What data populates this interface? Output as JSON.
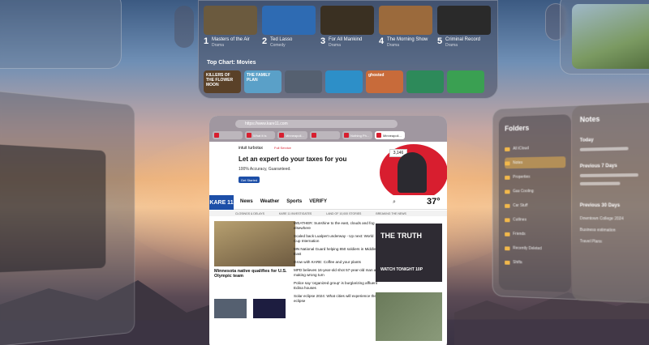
{
  "tv": {
    "top_tiles": [
      {
        "rank": "1",
        "title": "Masters of the Air",
        "genre": "Drama",
        "color": "#6b5a3e"
      },
      {
        "rank": "2",
        "title": "Ted Lasso",
        "genre": "Comedy",
        "color": "#2e6bb3"
      },
      {
        "rank": "3",
        "title": "For All Mankind",
        "genre": "Drama",
        "color": "#3a3022"
      },
      {
        "rank": "4",
        "title": "The Morning Show",
        "genre": "Drama",
        "color": "#9b6a3c"
      },
      {
        "rank": "5",
        "title": "Criminal Record",
        "genre": "Drama",
        "color": "#2a2a2a"
      }
    ],
    "chart_title": "Top Chart: Movies",
    "movie_tiles": [
      {
        "text": "KILLERS OF THE FLOWER MOON",
        "color": "#5a4128"
      },
      {
        "text": "THE FAMILY PLAN",
        "color": "#5aa0c8"
      },
      {
        "text": "",
        "color": "#556070"
      },
      {
        "text": "",
        "color": "#2d8fc8"
      },
      {
        "text": "ghosted",
        "color": "#c86b3a"
      },
      {
        "text": "",
        "color": "#2d8a5a"
      },
      {
        "text": "",
        "color": "#3aa052"
      }
    ]
  },
  "browser": {
    "url": "https://www.kare11.com",
    "tabs": [
      "",
      "What it is",
      "Minneapoli...",
      "",
      "Nothing Ph...",
      "Minneapoli..."
    ],
    "ad": {
      "brand": "intuit turbotax",
      "tag": "Full Service",
      "headline": "Let an expert do your taxes for you",
      "sub": "100% Accuracy, Guaranteed.",
      "cta": "Get Started",
      "phone_value": "3,146"
    },
    "site": {
      "logo": "KARE 11",
      "nav": [
        "News",
        "Weather",
        "Sports",
        "VERIFY"
      ],
      "temperature": "37°",
      "ticker": [
        "CLOSINGS & DELAYS",
        "KARE 11 INVESTIGATES",
        "LAND OF 10,000 STORIES",
        "BREAKING THE NEWS"
      ],
      "hero_headline": "Minnesota native qualifies for U.S. Olympic team",
      "headlines": [
        "WEATHER: Sunshine to the east, clouds and fog elsewhere",
        "Scaled back Lualpert underway - Up next: World Cup Internation",
        "MN National Guard helping 850 soldiers in Middle East",
        "Grow with KARE: Coffee and your plants",
        "MPD believes 16-year-old shot 57-year-old man after making wrong turn",
        "Police say 'organized group' is burglarizing affluent Edina houses",
        "Solar eclipse 2024: What cities will experience the eclipse"
      ],
      "promo_title": "THE TRUTH",
      "promo_sub": "WATCH TONIGHT 10P"
    }
  },
  "folders": {
    "title": "Folders",
    "items": [
      "All iCloud",
      "Notes",
      "Properties",
      "Gas Cooling",
      "Car Stuff",
      "Cutlines",
      "Friends",
      "Recently Deleted",
      "Shifts"
    ]
  },
  "notes": {
    "title": "Notes",
    "sections": [
      "Today",
      "Previous 7 Days",
      "Previous 30 Days"
    ],
    "items": [
      "Downtown College 2024",
      "Business estimation",
      "Travel Plans"
    ]
  }
}
